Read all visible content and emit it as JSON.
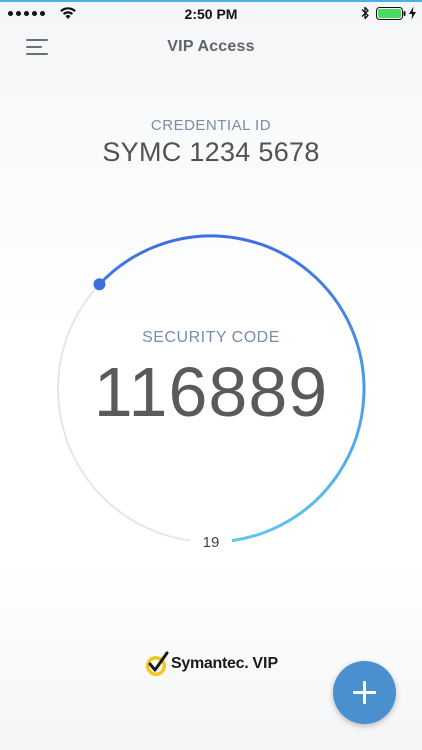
{
  "status_bar": {
    "time": "2:50 PM",
    "battery_color": "#4cd964"
  },
  "nav": {
    "title": "VIP Access",
    "menu_icon": "hamburger-menu-icon"
  },
  "credential": {
    "label": "CREDENTIAL ID",
    "value": "SYMC 1234 5678"
  },
  "security": {
    "label": "SECURITY CODE",
    "code": "116889",
    "seconds_remaining": "19",
    "timer_fraction_remaining": 0.63
  },
  "logo": {
    "brand": "Symantec.",
    "product": "VIP",
    "check_color": "#f5c518"
  },
  "fab": {
    "icon": "plus-icon",
    "color": "#4a90cf"
  },
  "colors": {
    "accent_blue": "#3d6fe0",
    "accent_cyan": "#5bc7ee",
    "track": "#e6e6e6",
    "label_blue": "#7a8ca8"
  }
}
